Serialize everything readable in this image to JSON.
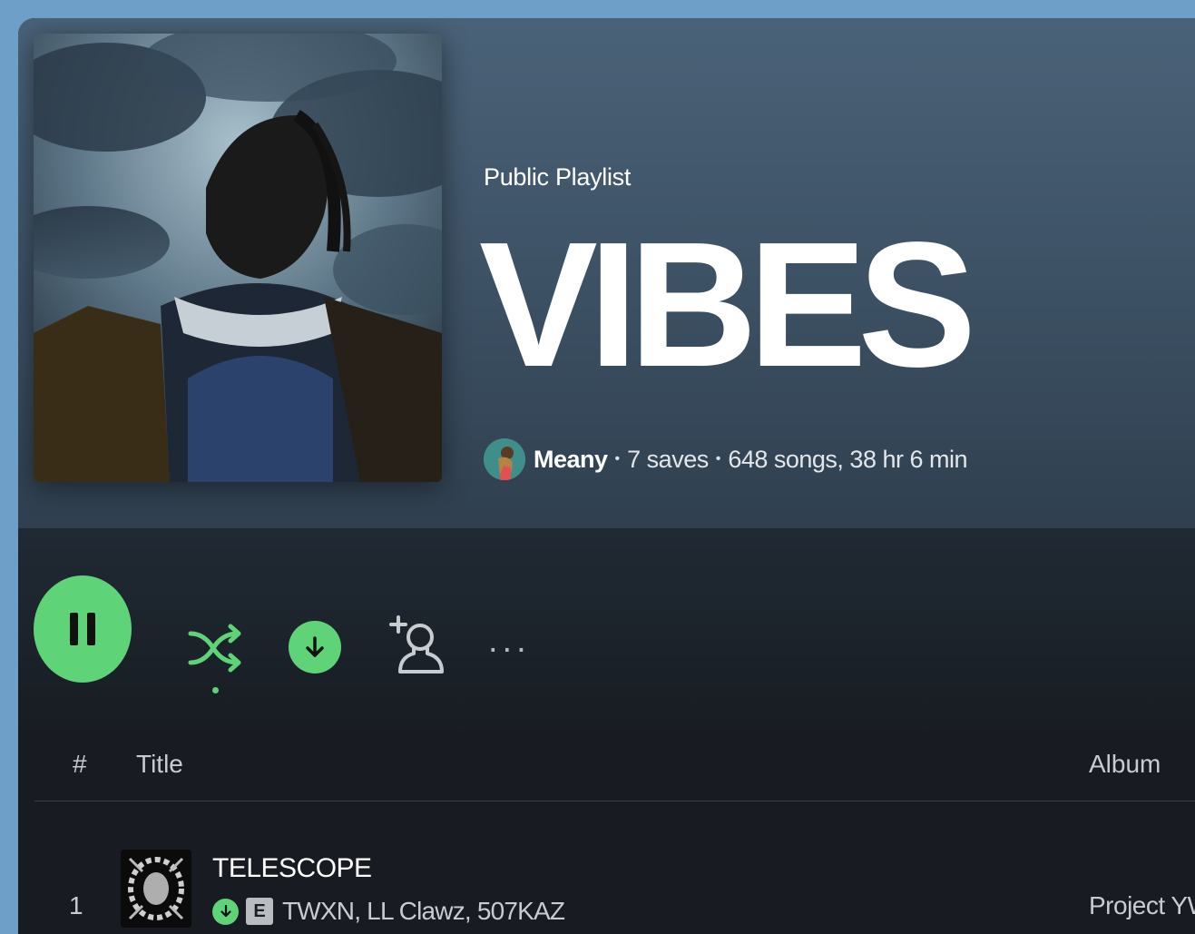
{
  "playlist": {
    "type_label": "Public Playlist",
    "title": "VIBES",
    "owner": "Meany",
    "saves": "7 saves",
    "summary": "648 songs, 38 hr 6 min",
    "separator": "•"
  },
  "controls": {
    "play_state": "playing",
    "shuffle_active": true,
    "downloaded": true,
    "more_label": "..."
  },
  "table": {
    "columns": {
      "num": "#",
      "title": "Title",
      "album": "Album"
    },
    "rows": [
      {
        "num": "1",
        "title": "TELESCOPE",
        "explicit_label": "E",
        "artists": "TWXN, LL Clawz, 507KAZ",
        "album": "Project YW"
      }
    ]
  },
  "colors": {
    "accent": "#5fd377",
    "header_top": "#4a6278",
    "background": "#181c22",
    "outer": "#6e9fc9"
  },
  "icons": [
    "pause-icon",
    "shuffle-icon",
    "download-icon",
    "add-user-icon",
    "more-options-icon"
  ]
}
